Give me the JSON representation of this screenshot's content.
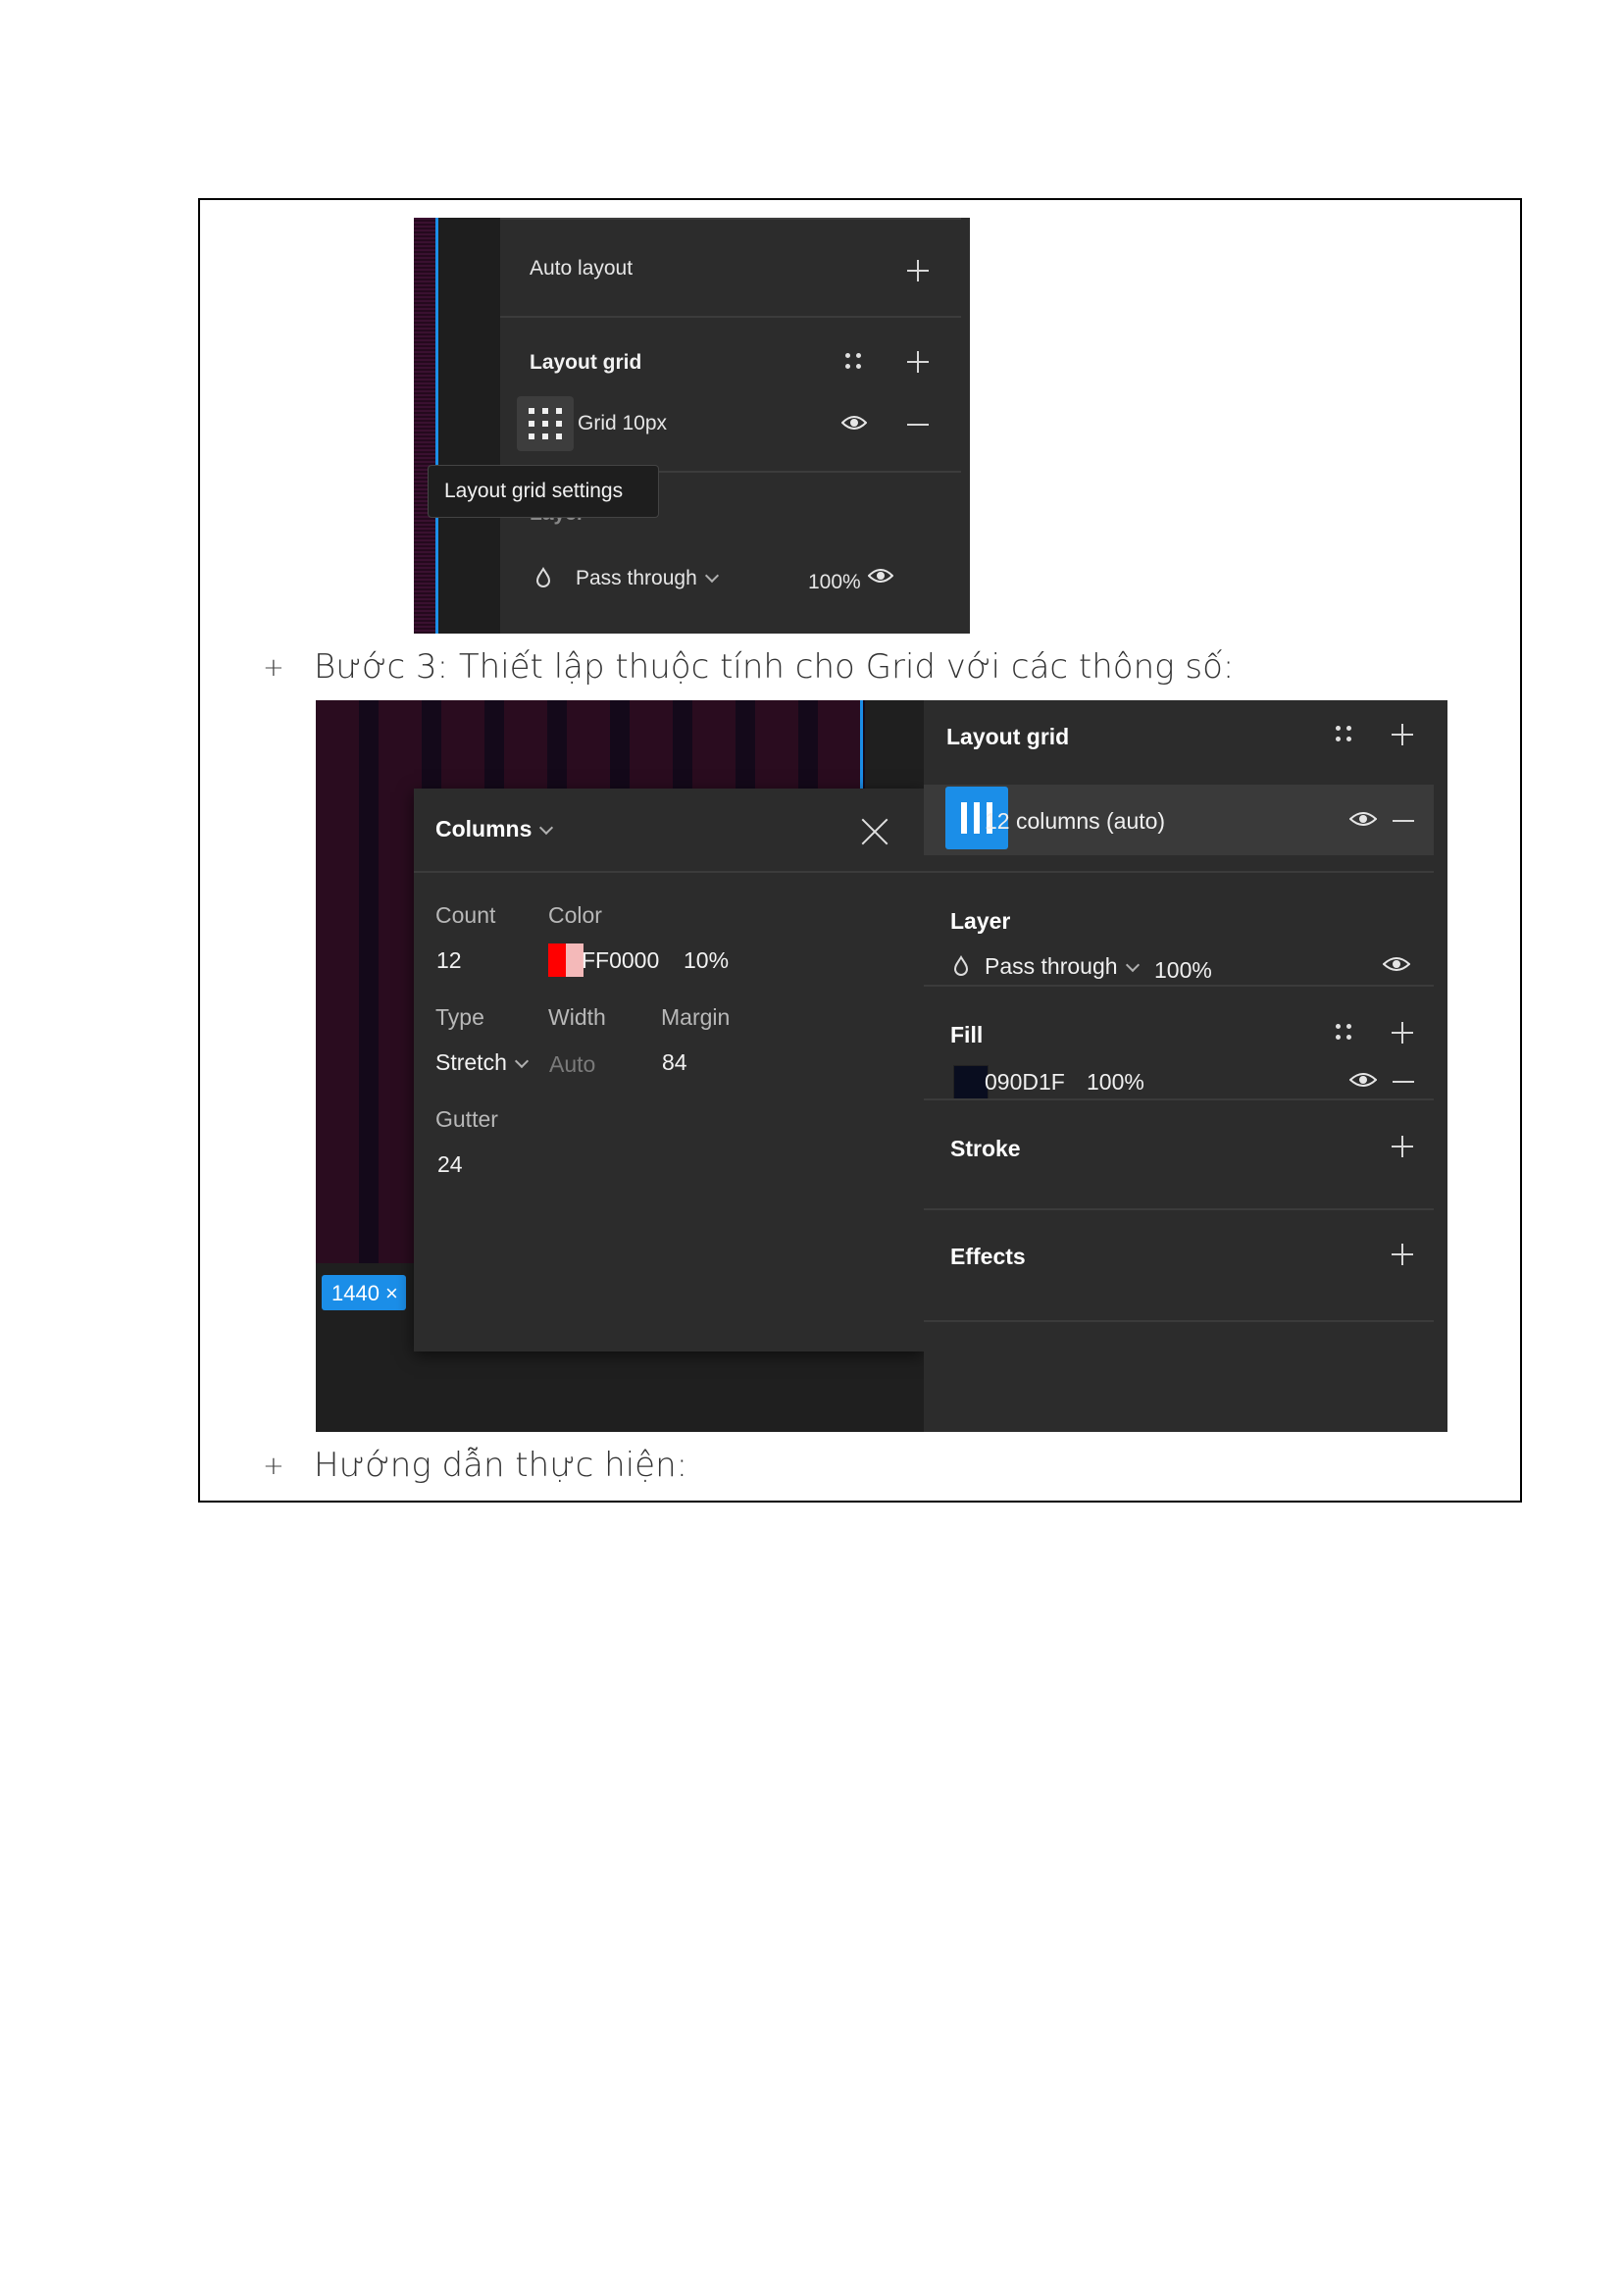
{
  "shot1": {
    "auto_layout": "Auto layout",
    "layout_grid": "Layout grid",
    "grid_item": "Grid 10px",
    "tooltip": "Layout grid settings",
    "layer_partial": "Layer",
    "blend_mode": "Pass through",
    "opacity": "100%"
  },
  "step3": {
    "bullet": "+",
    "text": "Bước 3: Thiết lập thuộc tính cho Grid với các thông số:"
  },
  "shot2": {
    "frame_badge": "1440 ×",
    "popup": {
      "title": "Columns",
      "count_label": "Count",
      "count_value": "12",
      "color_label": "Color",
      "color_hex": "FF0000",
      "color_opacity": "10%",
      "type_label": "Type",
      "type_value": "Stretch",
      "width_label": "Width",
      "width_value": "Auto",
      "margin_label": "Margin",
      "margin_value": "84",
      "gutter_label": "Gutter",
      "gutter_value": "24"
    },
    "panel": {
      "layout_grid": "Layout grid",
      "grid_item": "12 columns (auto)",
      "layer": "Layer",
      "blend_mode": "Pass through",
      "layer_opacity": "100%",
      "fill": "Fill",
      "fill_hex": "090D1F",
      "fill_opacity": "100%",
      "stroke": "Stroke",
      "effects": "Effects"
    },
    "colors": {
      "grid_color": "#FF0000",
      "fill_color": "#090D1F",
      "accent": "#1B8EE8"
    }
  },
  "guide": {
    "bullet": "+",
    "text": "Hướng dẫn thực hiện:"
  }
}
